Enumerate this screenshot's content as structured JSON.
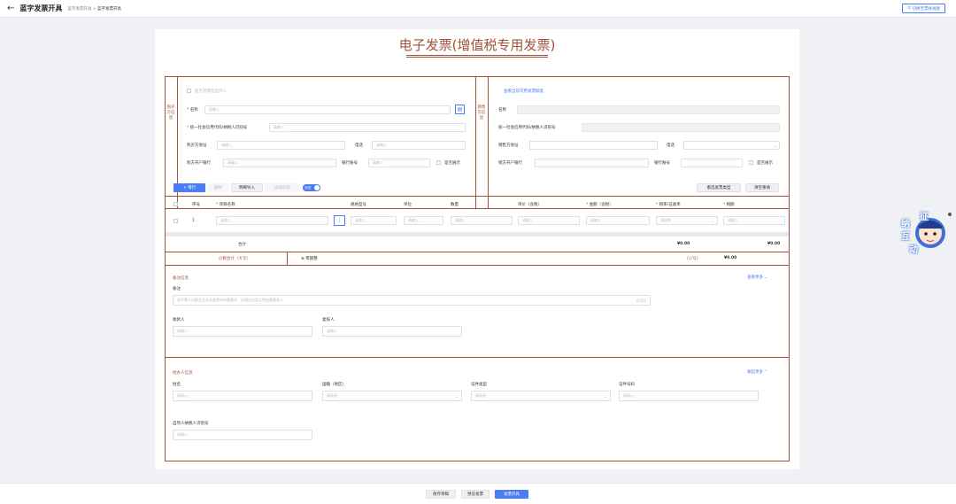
{
  "header": {
    "back_icon": "arrow-left-icon",
    "title": "蓝字发票开具",
    "breadcrumb_root": "蓝字发票开具",
    "breadcrumb_sep": ">",
    "breadcrumb_current": "蓝字发票开具",
    "switch_label": "切换至票样视图"
  },
  "document": {
    "title": "电子发票(增值税专用发票)",
    "accent_color": "#a0523a"
  },
  "buyer": {
    "side_label": "购买方信息",
    "natural_person_label": "是否开票给自然人",
    "name_label": "名称",
    "name_placeholder": "请输入",
    "taxid_label": "统一社会信用代码/纳税人识别号",
    "taxid_placeholder": "请输入",
    "address_label": "购买方地址",
    "address_placeholder": "请输入",
    "phone_label": "电话",
    "phone_placeholder": "请输入",
    "bank_label": "购方开户银行",
    "bank_placeholder": "请输入",
    "account_label": "银行账号",
    "account_placeholder": "请输入",
    "show_label": "是否展示"
  },
  "seller": {
    "side_label": "销售方信息",
    "link": "查看当前可用发票额度",
    "name_label": "名称",
    "taxid_label": "统一社会信用代码/纳税人识别号",
    "address_label": "销售方地址",
    "phone_label": "电话",
    "bank_label": "销方开户银行",
    "account_label": "银行账号",
    "show_label": "是否展示"
  },
  "toolbar": {
    "add_row": "+ 增行",
    "delete": "删除",
    "detail_import": "明细导入",
    "add_discount": "添加折扣",
    "toggle_label": "含税",
    "reselect_type": "重选发票类型",
    "clear_reset": "清空重填"
  },
  "table": {
    "headers": [
      "序号",
      "项目名称",
      "规格型号",
      "单位",
      "数量",
      "单价（含税）",
      "金额（含税）",
      "税率/征收率",
      "税额"
    ],
    "row_index": "1",
    "placeholder": "请输入",
    "select_placeholder": "请选择",
    "total_label": "合计",
    "total_amount": "¥0.00",
    "total_tax": "¥0.00",
    "grand_label": "价税合计（大写）",
    "grand_value": "零圆整",
    "small_label": "(小写)",
    "small_value": "¥0.00"
  },
  "remarks": {
    "section": "备注信息",
    "more": "查看更多",
    "label": "备注",
    "placeholder": "如开票人对备注文本长度等有特殊需求，由通过自定义附加要素录入",
    "count": "0/200",
    "payee_label": "收款人",
    "payee_placeholder": "请输入",
    "reviewer_label": "复核人",
    "reviewer_placeholder": "请输入"
  },
  "agent": {
    "section": "经办人信息",
    "collapse": "收起更多",
    "name_label": "姓名",
    "name_placeholder": "请输入",
    "country_label": "国籍（地区）",
    "country_placeholder": "请选择",
    "idtype_label": "证件类型",
    "idtype_placeholder": "请选择",
    "idno_label": "证件号码",
    "idno_placeholder": "请输入",
    "taxid_label": "自然人纳税人识别号",
    "taxid_placeholder": "请输入"
  },
  "footer": {
    "save_draft": "保存草稿",
    "preview": "预览发票",
    "issue": "发票开具"
  },
  "widget": {
    "text": [
      "征",
      "纳",
      "互",
      "动"
    ],
    "icon": "assistant-mascot-icon"
  }
}
